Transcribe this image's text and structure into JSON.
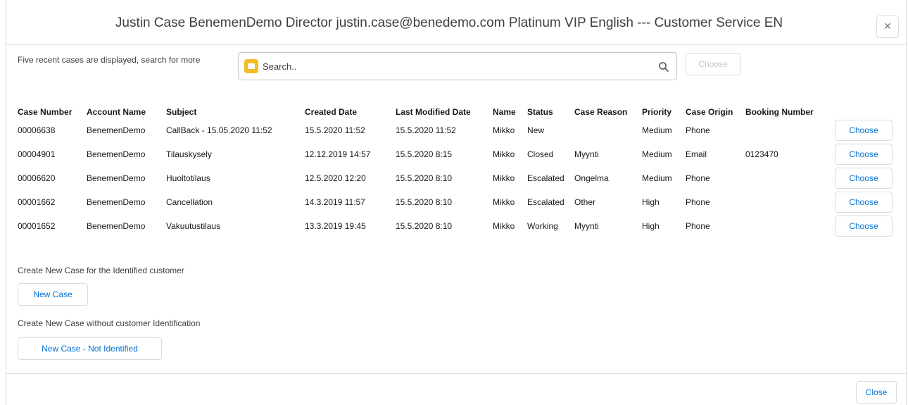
{
  "header": {
    "title": "Justin Case BenemenDemo Director justin.case@benedemo.com Platinum VIP English --- Customer Service EN",
    "close_icon": "close-icon",
    "close_glyph": "×"
  },
  "search": {
    "label": "Five recent cases are displayed, search for more",
    "placeholder": "Search..",
    "value": "",
    "choose_label": "Choose"
  },
  "table": {
    "headers": [
      "Case Number",
      "Account Name",
      "Subject",
      "Created Date",
      "Last Modified Date",
      "Name",
      "Status",
      "Case Reason",
      "Priority",
      "Case Origin",
      "Booking Number"
    ],
    "rows": [
      {
        "case_number": "00006638",
        "account_name": "BenemenDemo",
        "subject": "CallBack - 15.05.2020 11:52",
        "created_date": "15.5.2020 11:52",
        "last_modified": "15.5.2020 11:52",
        "name": "Mikko",
        "status": "New",
        "case_reason": "",
        "priority": "Medium",
        "case_origin": "Phone",
        "booking_number": "",
        "choose_label": "Choose"
      },
      {
        "case_number": "00004901",
        "account_name": "BenemenDemo",
        "subject": "Tilauskysely",
        "created_date": "12.12.2019 14:57",
        "last_modified": "15.5.2020 8:15",
        "name": "Mikko",
        "status": "Closed",
        "case_reason": "Myynti",
        "priority": "Medium",
        "case_origin": "Email",
        "booking_number": "0123470",
        "choose_label": "Choose"
      },
      {
        "case_number": "00006620",
        "account_name": "BenemenDemo",
        "subject": "Huoltotilaus",
        "created_date": "12.5.2020 12:20",
        "last_modified": "15.5.2020 8:10",
        "name": "Mikko",
        "status": "Escalated",
        "case_reason": "Ongelma",
        "priority": "Medium",
        "case_origin": "Phone",
        "booking_number": "",
        "choose_label": "Choose"
      },
      {
        "case_number": "00001662",
        "account_name": "BenemenDemo",
        "subject": "Cancellation",
        "created_date": "14.3.2019 11:57",
        "last_modified": "15.5.2020 8:10",
        "name": "Mikko",
        "status": "Escalated",
        "case_reason": "Other",
        "priority": "High",
        "case_origin": "Phone",
        "booking_number": "",
        "choose_label": "Choose"
      },
      {
        "case_number": "00001652",
        "account_name": "BenemenDemo",
        "subject": "Vakuutustilaus",
        "created_date": "13.3.2019 19:45",
        "last_modified": "15.5.2020 8:10",
        "name": "Mikko",
        "status": "Working",
        "case_reason": "Myynti",
        "priority": "High",
        "case_origin": "Phone",
        "booking_number": "",
        "choose_label": "Choose"
      }
    ]
  },
  "new_case": {
    "identified_label": "Create New Case for the Identified customer",
    "identified_button": "New Case",
    "unidentified_label": "Create New Case without customer Identification",
    "unidentified_button": "New Case - Not Identified"
  },
  "footer": {
    "close_label": "Close"
  },
  "icons": {
    "calendar": "calendar-icon",
    "search": "search-icon"
  },
  "colors": {
    "accent": "#0070d2",
    "calendar_icon": "#f4bc25",
    "border": "#dddbda"
  }
}
